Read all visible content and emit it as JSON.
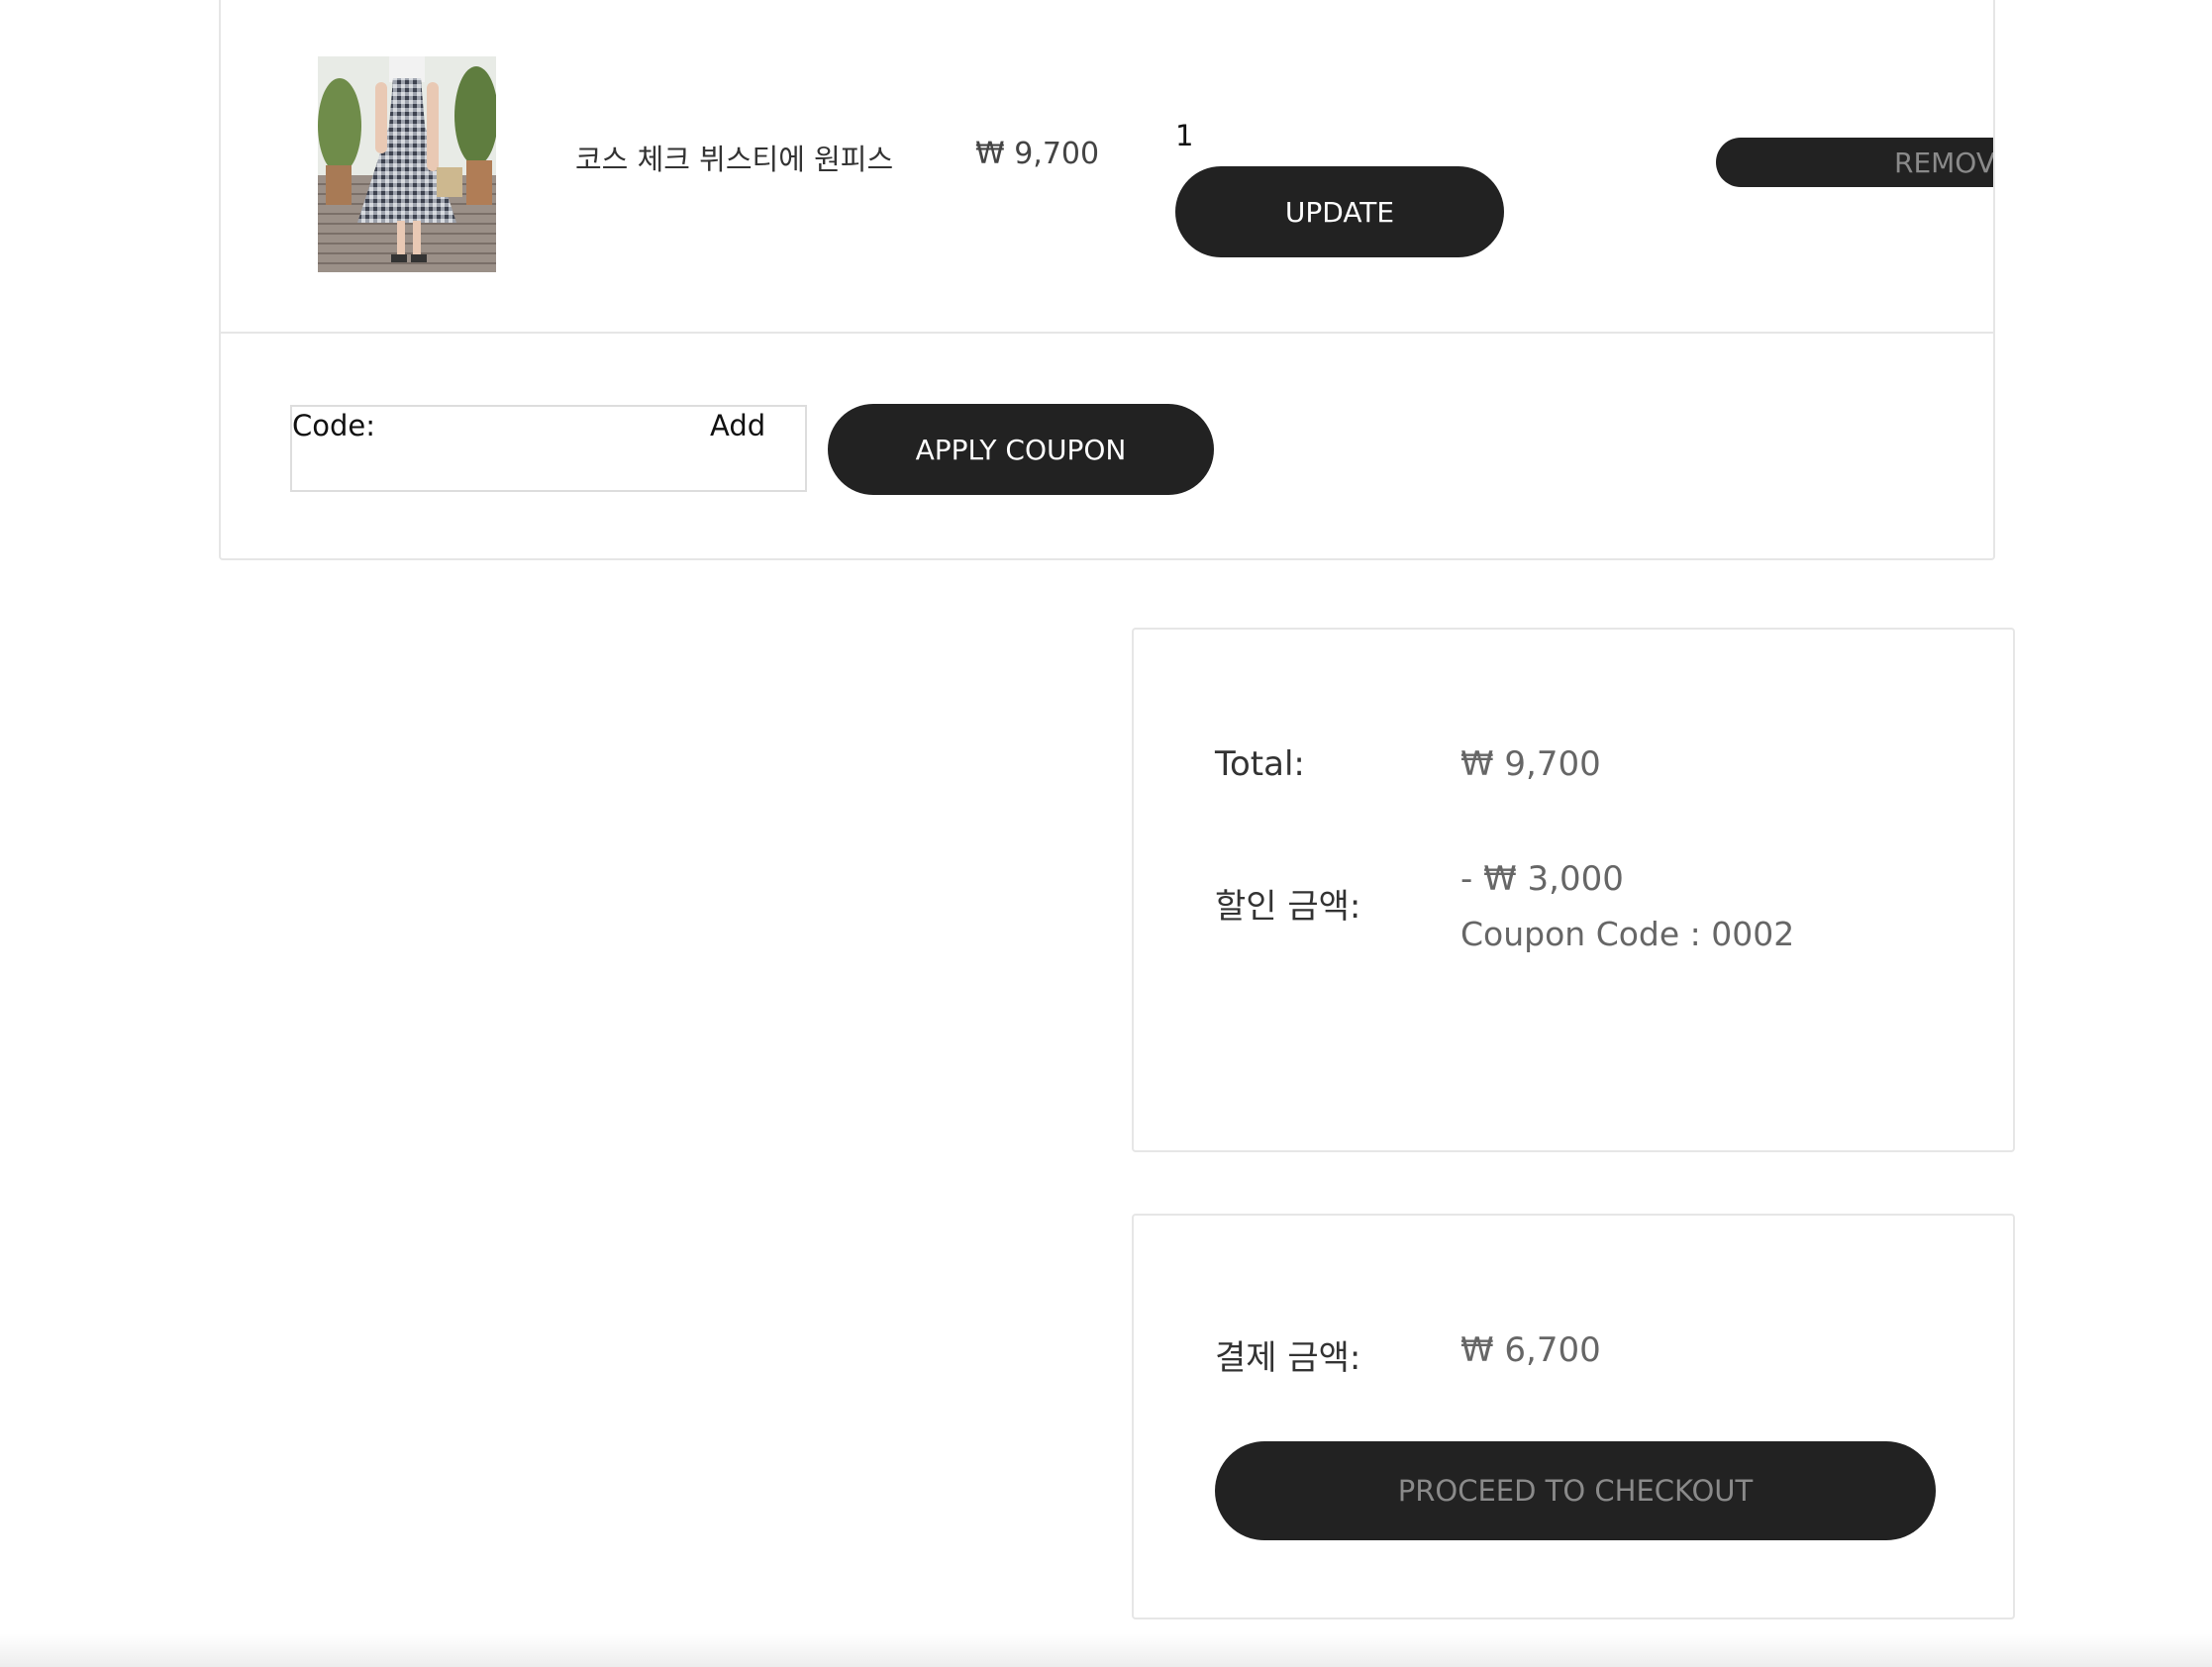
{
  "cart": {
    "item": {
      "name": "코스 체크 뷔스티에 원피스",
      "price": "₩ 9,700",
      "quantity": "1",
      "update_label": "UPDATE",
      "remove_label": "REMOVE"
    },
    "coupon": {
      "label": "Code:",
      "add_label": "Add",
      "value": "",
      "apply_label": "APPLY COUPON"
    }
  },
  "summary": {
    "total_label": "Total:",
    "total_value": "₩ 9,700",
    "discount_label": "할인 금액:",
    "discount_value": "- ₩ 3,000",
    "coupon_code_text": "Coupon Code : 0002"
  },
  "payment": {
    "label": "결제 금액:",
    "value": "₩ 6,700",
    "checkout_label": "PROCEED TO CHECKOUT"
  },
  "colors": {
    "button_dark": "#222222",
    "border": "#e6e6e6",
    "muted_text": "#666666"
  }
}
